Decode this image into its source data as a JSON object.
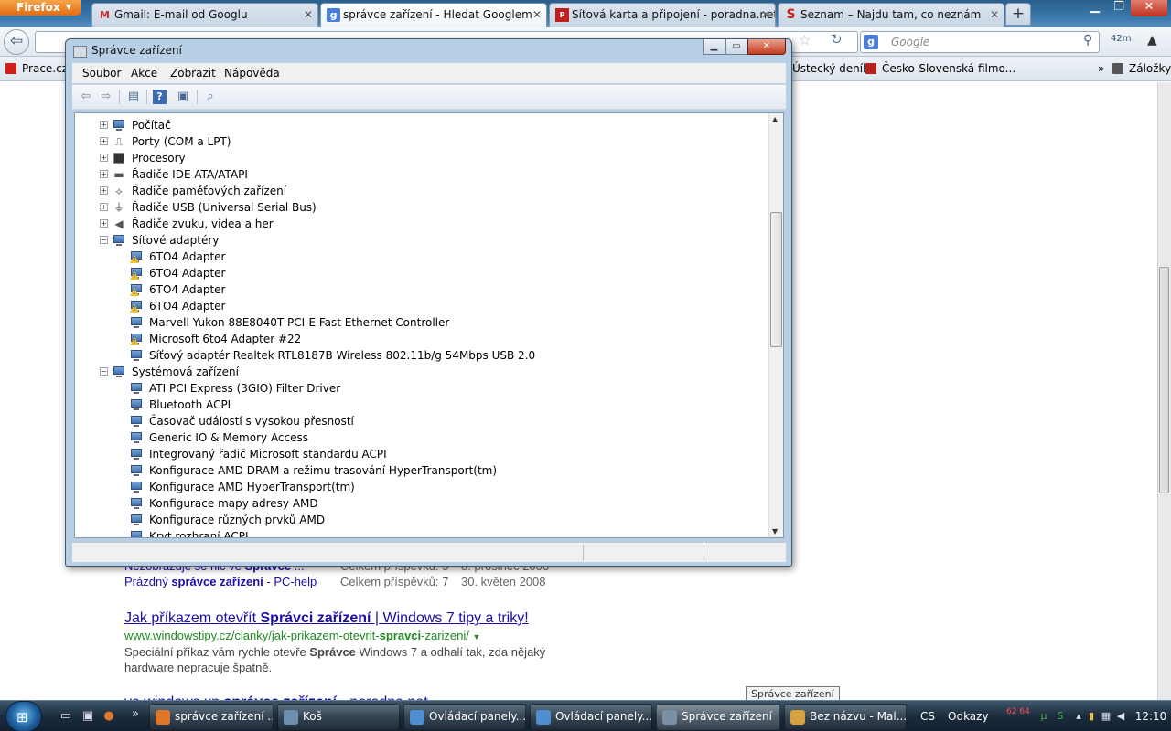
{
  "firefox": {
    "button_label": "Firefox",
    "tabs": [
      {
        "label": "Gmail: E-mail od Googlu",
        "icon": "gmail-icon"
      },
      {
        "label": "správce zařízení - Hledat Googlem",
        "icon": "google-icon"
      },
      {
        "label": "Síťová karta a připojení - poradna.net",
        "icon": "poradna-icon"
      },
      {
        "label": "Seznam – Najdu tam, co neznám",
        "icon": "seznam-icon"
      }
    ],
    "new_tab_label": "+",
    "search_placeholder": "Google",
    "addon_badge": "42m",
    "bookmarks": [
      "Prace.cz",
      "Ústecký deník",
      "Česko-Slovenská filmo...",
      "Záložky"
    ],
    "bookmarks_overflow": "»"
  },
  "page": {
    "partial_row": {
      "title_prefix": "Nezobrazuje se nic ve ",
      "title_bold": "Správce",
      "title_suffix": " ...",
      "posts": "Celkem příspěvků: 5",
      "date": "8. prosinec 2006"
    },
    "row2": {
      "title_prefix": "Prázdný ",
      "title_bold": "správce zařízení",
      "title_suffix": " - PC-help",
      "posts": "Celkem příspěvků: 7",
      "date": "30. květen 2008"
    },
    "result": {
      "title_prefix": "Jak příkazem otevřít ",
      "title_bold": "Správci zařízení",
      "title_suffix": " | Windows 7 tipy a triky!",
      "url_prefix": "www.windowstipy.cz/clanky/jak-prikazem-otevrit-",
      "url_bold": "spravci",
      "url_suffix": "-zarizeni/",
      "snippet_line1_prefix": "Speciální příkaz vám rychle otevře ",
      "snippet_line1_bold": "Správce",
      "snippet_line1_suffix": " Windows 7 a odhalí tak, zda nějaký",
      "snippet_line2": "hardware nepracuje špatně."
    },
    "cut_result": {
      "title_prefix": "ve windows xp ",
      "title_bold": "správce zařízení",
      "title_suffix": " - poradna.net"
    }
  },
  "device_manager": {
    "title": "Správce zařízení",
    "menu": [
      "Soubor",
      "Akce",
      "Zobrazit",
      "Nápověda"
    ],
    "toolbar_icons": [
      "back-icon",
      "forward-icon",
      "properties-icon",
      "help-icon",
      "view-icon",
      "scan-hardware-icon"
    ],
    "tree": [
      {
        "label": "Počítač",
        "level": 0,
        "expander": "+",
        "icon": "computer"
      },
      {
        "label": "Porty (COM a LPT)",
        "level": 0,
        "expander": "+",
        "icon": "port"
      },
      {
        "label": "Procesory",
        "level": 0,
        "expander": "+",
        "icon": "chip"
      },
      {
        "label": "Řadiče IDE ATA/ATAPI",
        "level": 0,
        "expander": "+",
        "icon": "ide"
      },
      {
        "label": "Řadiče paměťových zařízení",
        "level": 0,
        "expander": "+",
        "icon": "storage"
      },
      {
        "label": "Řadiče USB (Universal Serial Bus)",
        "level": 0,
        "expander": "+",
        "icon": "usb"
      },
      {
        "label": "Řadiče zvuku, videa a her",
        "level": 0,
        "expander": "+",
        "icon": "sound"
      },
      {
        "label": "Síťové adaptéry",
        "level": 0,
        "expander": "−",
        "icon": "network"
      },
      {
        "label": "6TO4 Adapter",
        "level": 1,
        "icon": "network-warning"
      },
      {
        "label": "6TO4 Adapter",
        "level": 1,
        "icon": "network-warning"
      },
      {
        "label": "6TO4 Adapter",
        "level": 1,
        "icon": "network-warning"
      },
      {
        "label": "6TO4 Adapter",
        "level": 1,
        "icon": "network-warning"
      },
      {
        "label": "Marvell Yukon 88E8040T PCI-E Fast Ethernet Controller",
        "level": 1,
        "icon": "network"
      },
      {
        "label": "Microsoft 6to4 Adapter #22",
        "level": 1,
        "icon": "network-warning"
      },
      {
        "label": "Síťový adaptér Realtek RTL8187B Wireless 802.11b/g 54Mbps USB 2.0",
        "level": 1,
        "icon": "network"
      },
      {
        "label": "Systémová zařízení",
        "level": 0,
        "expander": "−",
        "icon": "computer"
      },
      {
        "label": "ATI PCI Express (3GIO) Filter Driver",
        "level": 1,
        "icon": "computer"
      },
      {
        "label": "Bluetooth ACPI",
        "level": 1,
        "icon": "computer"
      },
      {
        "label": "Časovač událostí s vysokou přesností",
        "level": 1,
        "icon": "computer"
      },
      {
        "label": "Generic IO & Memory Access",
        "level": 1,
        "icon": "computer"
      },
      {
        "label": "Integrovaný řadič Microsoft standardu ACPI",
        "level": 1,
        "icon": "computer"
      },
      {
        "label": "Konfigurace AMD DRAM a režimu trasování HyperTransport(tm)",
        "level": 1,
        "icon": "computer"
      },
      {
        "label": "Konfigurace AMD HyperTransport(tm)",
        "level": 1,
        "icon": "computer"
      },
      {
        "label": "Konfigurace mapy adresy AMD",
        "level": 1,
        "icon": "computer"
      },
      {
        "label": "Konfigurace různých prvků AMD",
        "level": 1,
        "icon": "computer"
      },
      {
        "label": "Kryt rozhraní ACPI",
        "level": 1,
        "icon": "computer"
      }
    ]
  },
  "tooltip": "Správce zařízení",
  "taskbar": {
    "tasks": [
      {
        "label": "správce zařízení ...",
        "icon": "firefox-icon",
        "color": "#e0762a"
      },
      {
        "label": "Koš",
        "icon": "recycle-bin-icon",
        "color": "#6d8fb0"
      },
      {
        "label": "Ovládací panely...",
        "icon": "control-panel-icon",
        "color": "#4f8fd0"
      },
      {
        "label": "Ovládací panely...",
        "icon": "control-panel-icon",
        "color": "#4f8fd0"
      },
      {
        "label": "Správce zařízení",
        "icon": "device-manager-icon",
        "color": "#7a8ea4"
      },
      {
        "label": "Bez názvu - Mal...",
        "icon": "paint-icon",
        "color": "#d6a040"
      }
    ],
    "language": "CS",
    "links_toolbar": "Odkazy",
    "net_speed": "62 64",
    "clock": "12:10"
  }
}
